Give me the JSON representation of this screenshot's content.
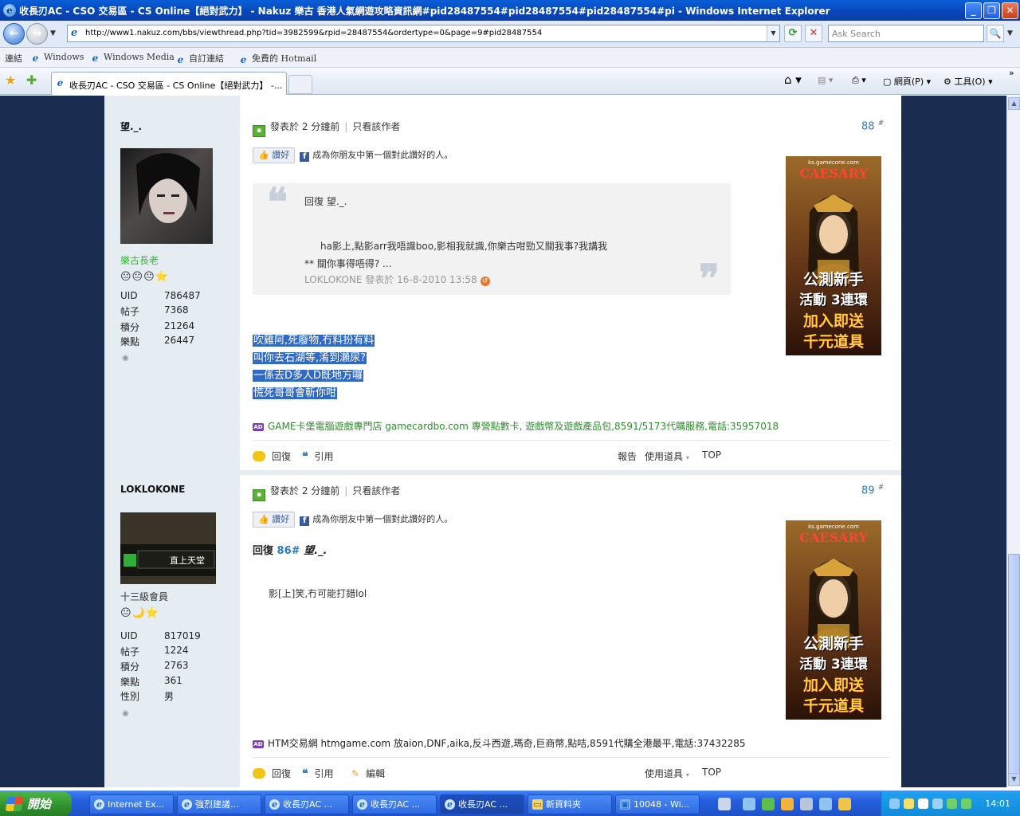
{
  "window": {
    "title": "收長刃AC - CSO 交易區 - CS Online【絕對武力】 - Nakuz 樂古 香港人氣網遊攻略資訊網#pid28487554#pid28487554#pid28487554#pi - Windows Internet Explorer"
  },
  "address": {
    "url": "http://www1.nakuz.com/bbs/viewthread.php?tid=3982599&rpid=28487554&ordertype=0&page=9#pid28487554",
    "search_placeholder": "Ask Search"
  },
  "links_bar": {
    "label": "連結",
    "items": [
      "Windows",
      "Windows Media",
      "自訂連結",
      "免費的 Hotmail"
    ]
  },
  "tabs": {
    "active_label": "收長刃AC - CSO 交易區 - CS Online【絕對武力】 -..."
  },
  "commands": {
    "page_label": "網頁(P)",
    "tools_label": "工具(O)"
  },
  "posts": [
    {
      "author": "望._.",
      "rank": "樂古長老",
      "rank_color": "#2dbb2d",
      "stars": "😐😐😐⭐",
      "stats": [
        {
          "k": "UID",
          "v": "786487"
        },
        {
          "k": "帖子",
          "v": "7368"
        },
        {
          "k": "積分",
          "v": "21264"
        },
        {
          "k": "樂點",
          "v": "26447"
        }
      ],
      "meta_time": "發表於 2 分鐘前",
      "meta_only": "只看該作者",
      "floor": "88",
      "like_label": "讚好",
      "like_text": "成為你朋友中第一個對此讚好的人。",
      "quote": {
        "line1": "回復  望._.",
        "line2": "ha影上,點影arr我唔識boo,影相我就識,你樂古咁勁又關我事?我講我",
        "line3": "** 關你事得唔得? ...",
        "footer": "LOKLOKONE 發表於 16-8-2010 13:58"
      },
      "body_lines": [
        "吹雞阿,死廢物,冇料扮有料",
        "叫你去石湖等,淆到瀨尿?",
        "一係去D多人D既地方囉",
        "慌死哥哥會斬你咁"
      ],
      "ad_text": "GAME卡堡電腦遊戲專門店 gamecardbo.com 專營點數卡, 遊戲幣及遊戲產品包,8591/5173代購服務,電話:35957018",
      "actions": {
        "reply": "回復",
        "quote": "引用",
        "report": "報告",
        "tools": "使用道具",
        "top": "TOP"
      }
    },
    {
      "author": "LOKLOKONE",
      "rank": "十三級會員",
      "stars": "😐🌙⭐",
      "stats": [
        {
          "k": "UID",
          "v": "817019"
        },
        {
          "k": "帖子",
          "v": "1224"
        },
        {
          "k": "積分",
          "v": "2763"
        },
        {
          "k": "樂點",
          "v": "361"
        },
        {
          "k": "性別",
          "v": "男"
        }
      ],
      "meta_time": "發表於 2 分鐘前",
      "meta_only": "只看該作者",
      "floor": "89",
      "like_label": "讚好",
      "like_text": "成為你朋友中第一個對此讚好的人。",
      "reply_prefix": "回復",
      "reply_num": "86#",
      "reply_who": "望._.",
      "body": "影[上]笑,冇可能打錯lol",
      "ad_text": "HTM交易網 htmgame.com 放aion,DNF,aika,反斗西遊,瑪奇,巨商幣,點咭,8591代購全港最平,電話:37432285",
      "actions": {
        "reply": "回復",
        "quote": "引用",
        "edit": "編輯",
        "tools": "使用道具",
        "top": "TOP"
      }
    }
  ],
  "banner": {
    "site": "ks.gamecone.com",
    "brand": "CAESARY",
    "line1": "公測新手",
    "line2": "活動 3連環",
    "line3": "加入即送",
    "line4": "千元道具"
  },
  "taskbar": {
    "start": "開始",
    "tasks": [
      "Internet Ex...",
      "強烈建議...",
      "收長刃AC ...",
      "收長刃AC ...",
      "收長刃AC ...",
      "新資料夾",
      "10048 - Wi..."
    ],
    "active_index": 4,
    "clock": "14:01"
  }
}
